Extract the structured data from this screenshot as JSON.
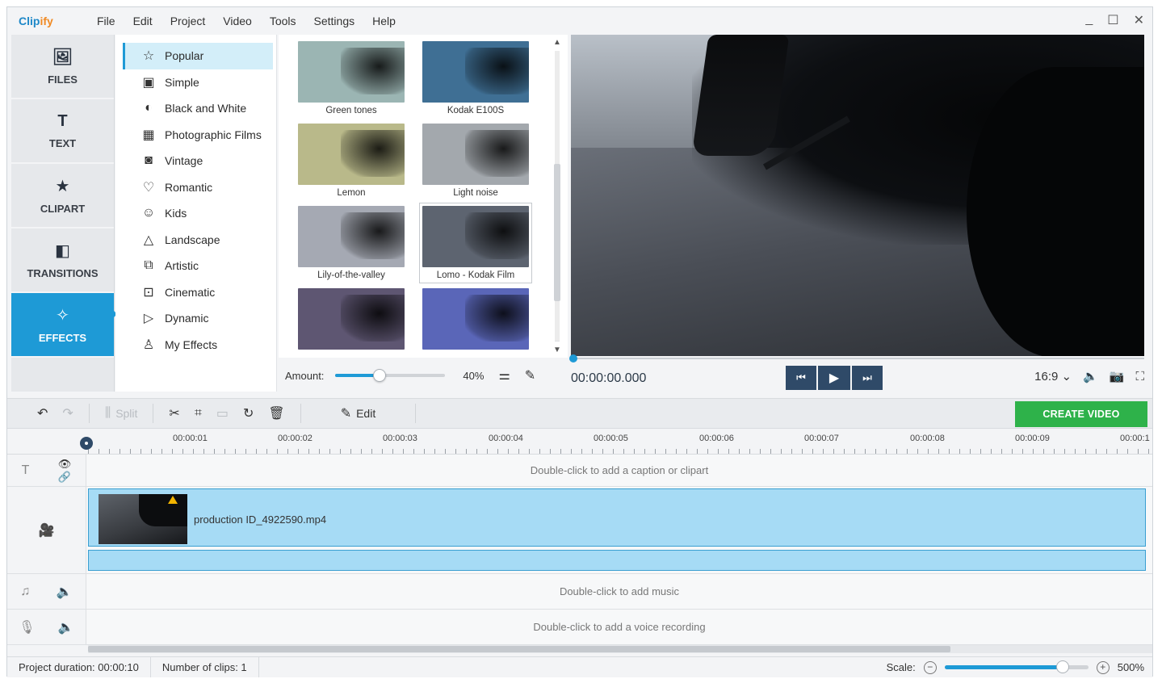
{
  "app": {
    "logo_main": "Clip",
    "logo_accent": "ify"
  },
  "menu": [
    "File",
    "Edit",
    "Project",
    "Video",
    "Tools",
    "Settings",
    "Help"
  ],
  "window_controls": [
    "_",
    "☐",
    "✕"
  ],
  "left_tabs": [
    {
      "label": "FILES",
      "icon": "image-icon",
      "active": false
    },
    {
      "label": "TEXT",
      "icon": "text-icon",
      "active": false
    },
    {
      "label": "CLIPART",
      "icon": "star-icon",
      "active": false
    },
    {
      "label": "TRANSITIONS",
      "icon": "transitions-icon",
      "active": false
    },
    {
      "label": "EFFECTS",
      "icon": "effects-icon",
      "active": true
    }
  ],
  "categories": [
    {
      "label": "Popular",
      "icon": "star-outline-icon",
      "active": true
    },
    {
      "label": "Simple",
      "icon": "simple-icon"
    },
    {
      "label": "Black and White",
      "icon": "bw-icon"
    },
    {
      "label": "Photographic Films",
      "icon": "film-icon"
    },
    {
      "label": "Vintage",
      "icon": "camera-icon"
    },
    {
      "label": "Romantic",
      "icon": "heart-icon"
    },
    {
      "label": "Kids",
      "icon": "kids-icon"
    },
    {
      "label": "Landscape",
      "icon": "mountain-icon"
    },
    {
      "label": "Artistic",
      "icon": "artistic-icon"
    },
    {
      "label": "Cinematic",
      "icon": "cinematic-icon"
    },
    {
      "label": "Dynamic",
      "icon": "play-circle-icon"
    },
    {
      "label": "My Effects",
      "icon": "user-icon"
    }
  ],
  "effects": [
    {
      "label": "Green tones",
      "color": "#9bb5b3"
    },
    {
      "label": "Kodak E100S",
      "color": "#3f6f94"
    },
    {
      "label": "Lemon",
      "color": "#b9b98a"
    },
    {
      "label": "Light noise",
      "color": "#a3a8ad"
    },
    {
      "label": "Lily-of-the-valley",
      "color": "#a5a9b3"
    },
    {
      "label": "Lomo - Kodak Film",
      "color": "#5d6470",
      "selected": true
    },
    {
      "label": "",
      "color": "#5e5672"
    },
    {
      "label": "",
      "color": "#5a66b8"
    }
  ],
  "amount": {
    "label": "Amount:",
    "value_text": "40%",
    "value": 0.4
  },
  "player": {
    "timecode": "00:00:00.000",
    "aspect": "16:9 ⌄",
    "prev_icon": "skip-back-icon",
    "play_icon": "play-icon",
    "next_icon": "skip-forward-icon"
  },
  "toolbar": {
    "split": "Split",
    "edit": "Edit",
    "create": "CREATE VIDEO"
  },
  "ruler": [
    "00:00:01",
    "00:00:02",
    "00:00:03",
    "00:00:04",
    "00:00:05",
    "00:00:06",
    "00:00:07",
    "00:00:08",
    "00:00:09",
    "00:00:1"
  ],
  "tracks": {
    "caption_hint": "Double-click to add a caption or clipart",
    "clip_name": "production ID_4922590.mp4",
    "music_hint": "Double-click to add music",
    "voice_hint": "Double-click to add a voice recording"
  },
  "status": {
    "duration": "Project duration:  00:00:10",
    "clips": "Number of clips:  1",
    "scale_label": "Scale:",
    "scale_value": "500%",
    "scale_fraction": 0.82
  }
}
